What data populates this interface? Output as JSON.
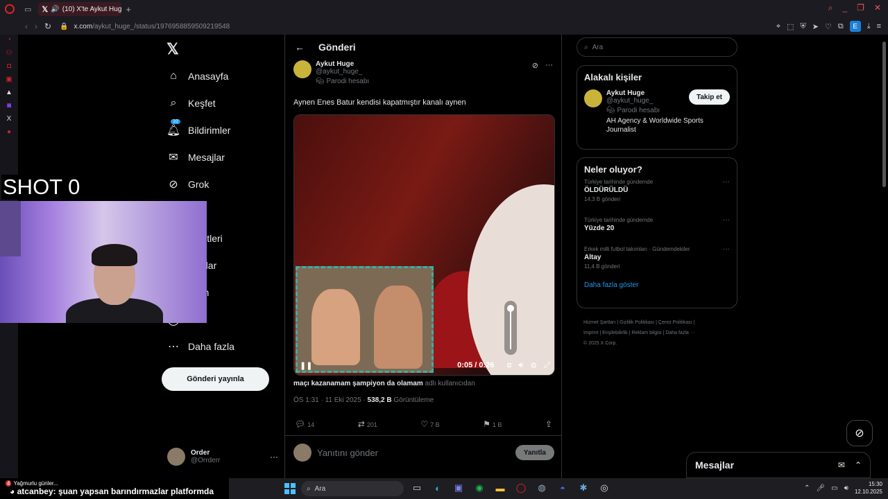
{
  "browser": {
    "tab_title": "(10) X'te Aykut Huge: \"",
    "url_host": "x.com",
    "url_path": "/aykut_huge_/status/1976958859509219548"
  },
  "nav": {
    "items": [
      {
        "label": "Anasayfa",
        "icon": "home-icon"
      },
      {
        "label": "Keşfet",
        "icon": "search-icon"
      },
      {
        "label": "Bildirimler",
        "icon": "bell-icon",
        "badge": "10"
      },
      {
        "label": "Mesajlar",
        "icon": "mail-icon"
      },
      {
        "label": "Grok",
        "icon": "grok-icon"
      },
      {
        "label": "eler",
        "icon": "list-icon"
      },
      {
        "label": "şaretleri",
        "icon": "bookmark-icon"
      },
      {
        "label": "uluklar",
        "icon": "community-icon"
      },
      {
        "label": "nium",
        "icon": "premium-icon"
      },
      {
        "label": "il",
        "icon": "profile-icon"
      },
      {
        "label": "Daha fazla",
        "icon": "more-icon"
      }
    ],
    "post_button": "Gönderi yayınla"
  },
  "account": {
    "name": "Order",
    "handle": "@Orrderr"
  },
  "header": {
    "title": "Gönderi"
  },
  "post": {
    "author_name": "Aykut Huge",
    "author_handle": "@aykut_huge_",
    "parody": "Parodi hesabı",
    "text": "Aynen Enes Batur kendisi kapatmıştır kanalı aynen",
    "video_time": "0:05 / 0:26",
    "caption_user": "maçı kazanamam şampiyon da olamam",
    "caption_suffix": "adlı kullanıcıdan",
    "timestamp": "ÖS 1:31 · 11 Eki 2025 ·",
    "views": "538,2 B",
    "views_label": "Görüntüleme",
    "replies": "14",
    "reposts": "201",
    "likes": "7 B",
    "bookmarks": "1 B",
    "reply_placeholder": "Yanıtını gönder",
    "reply_button": "Yanıtla"
  },
  "right": {
    "search_placeholder": "Ara",
    "related_title": "Alakalı kişiler",
    "related": {
      "name": "Aykut Huge",
      "handle": "@aykut_huge_",
      "parody": "Parodi hesabı",
      "bio": "AH Agency & Worldwide Sports Journalist",
      "follow": "Takip et"
    },
    "trends_title": "Neler oluyor?",
    "trends": [
      {
        "context": "Türkiye tarihinde gündemde",
        "title": "ÖLDÜRÜLDÜ",
        "count": "14,3 B gönderi"
      },
      {
        "context": "Türkiye tarihinde gündemde",
        "title": "Yüzde 20",
        "count": ""
      },
      {
        "context": "Erkek milli futbol takımları · Gündemdekiler",
        "title": "Altay",
        "count": "11,4 B gönderi"
      }
    ],
    "show_more": "Daha fazla göster",
    "footer": {
      "l1": "Hizmet Şartları",
      "l2": "Gizlilik Politikası",
      "l3": "Çerez Politikası",
      "l4": "Imprint",
      "l5": "Erişilebilirlik",
      "l6": "Reklam bilgisi",
      "l7": "Daha fazla ···",
      "copy": "© 2025 X Corp."
    }
  },
  "messages_panel": {
    "title": "Mesajlar"
  },
  "overlay": {
    "shot": "SHOT 0",
    "chat_weather": "Yağmurlu günler...",
    "chat_count": "4",
    "chat_user": "atcanbey",
    "chat_text": ": şuan yapsan barındırmazlar platformda"
  },
  "taskbar": {
    "search": "Ara",
    "time": "15:30",
    "date": "12.10.2025"
  }
}
